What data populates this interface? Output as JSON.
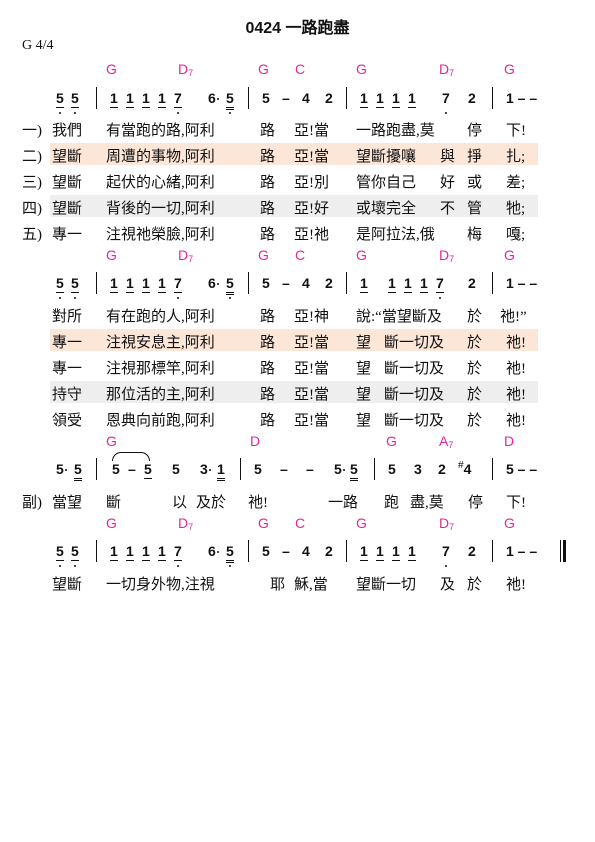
{
  "title": "0424  一路跑盡",
  "key": "G    4/4",
  "systems": [
    {
      "chords": [
        "G",
        "D7",
        "G",
        "C",
        "G",
        "D7",
        "G"
      ],
      "notes": [
        "5̣ 5̣",
        "1̲ 1̲ 1̲ 1̲ 7̣ 6̣·5̣",
        "5 – 4  2",
        "1̲ 1̲ 1̲ 1̲  7̣  2",
        "1 – –"
      ],
      "verses": [
        {
          "label": "一)",
          "segments": [
            "我們",
            "有當跑的路,阿利",
            "路",
            "亞!當",
            "一路跑盡,莫",
            "停",
            "下!"
          ]
        },
        {
          "label": "二)",
          "segments": [
            "望斷",
            "周遭的事物,阿利",
            "路",
            "亞!當",
            "望斷擾嚷",
            "與",
            "掙",
            "扎;"
          ]
        },
        {
          "label": "三)",
          "segments": [
            "望斷",
            "起伏的心緒,阿利",
            "路",
            "亞!別",
            "管你自己",
            "好",
            "或",
            "差;"
          ]
        },
        {
          "label": "四)",
          "segments": [
            "望斷",
            "背後的一切,阿利",
            "路",
            "亞!好",
            "或壞完全",
            "不",
            "管",
            "牠;"
          ]
        },
        {
          "label": "五)",
          "segments": [
            "專一",
            "注視祂榮臉,阿利",
            "路",
            "亞!祂",
            "是阿拉法,俄",
            "梅",
            "嘎;"
          ]
        }
      ]
    },
    {
      "chords": [
        "G",
        "D7",
        "G",
        "C",
        "G",
        "D7",
        "G"
      ],
      "lines": [
        {
          "label": "",
          "segments": [
            "對所",
            "有在跑的人,阿利",
            "路",
            "亞!神",
            "說:“當望斷及",
            "於",
            "祂!”"
          ]
        },
        {
          "label": "",
          "segments": [
            "專一",
            "注視安息主,阿利",
            "路",
            "亞!當",
            "望",
            "斷一切及",
            "於",
            "祂!"
          ]
        },
        {
          "label": "",
          "segments": [
            "專一",
            "注視那標竿,阿利",
            "路",
            "亞!當",
            "望",
            "斷一切及",
            "於",
            "祂!"
          ]
        },
        {
          "label": "",
          "segments": [
            "持守",
            "那位活的主,阿利",
            "路",
            "亞!當",
            "望",
            "斷一切及",
            "於",
            "祂!"
          ]
        },
        {
          "label": "",
          "segments": [
            "領受",
            "恩典向前跑,阿利",
            "路",
            "亞!當",
            "望",
            "斷一切及",
            "於",
            "祂!"
          ]
        }
      ]
    },
    {
      "chords": [
        "G",
        "D",
        "G",
        "A7",
        "D"
      ],
      "lines": [
        {
          "label": "副)",
          "segments": [
            "當望",
            "斷",
            "以",
            "及於",
            "祂!",
            "一路",
            "跑",
            "盡,莫",
            "停",
            "下!"
          ]
        }
      ]
    },
    {
      "chords": [
        "G",
        "D7",
        "G",
        "C",
        "G",
        "D7",
        "G"
      ],
      "lines": [
        {
          "label": "",
          "segments": [
            "望斷",
            "一切身外物,注視",
            "耶",
            "穌,當",
            "望斷一切",
            "及",
            "於",
            "祂!"
          ]
        }
      ]
    }
  ],
  "highlight": {
    "pink": "#fce6d8",
    "grey": "#eeeeee",
    "chord": "#e0289b"
  }
}
